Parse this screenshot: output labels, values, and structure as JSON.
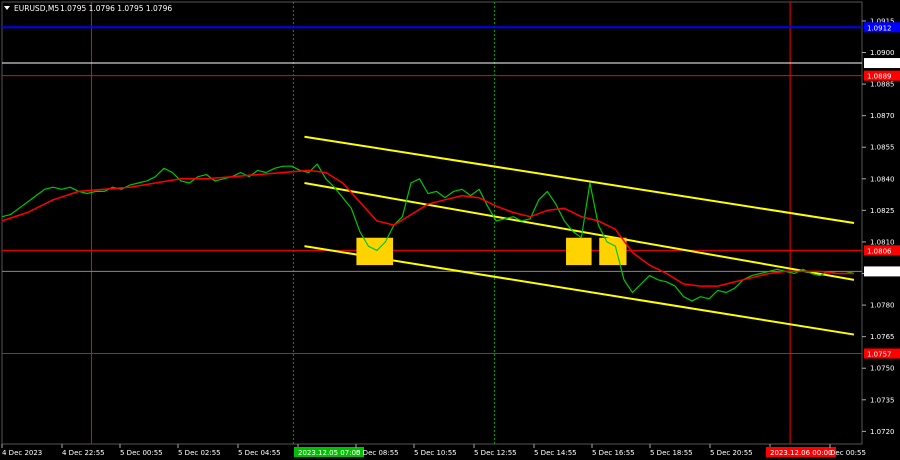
{
  "header": {
    "symbol": "EURUSD,M5",
    "ohlc": "1.0795 1.0796 1.0795 1.0796"
  },
  "colors": {
    "background": "#000000",
    "grid": "#2b2b2b",
    "price_line": "#00c800",
    "moving_average": "#ff0000",
    "channel": "#ffff00",
    "signal_box": "#ffd200",
    "level_red": "#ff0000",
    "level_blue": "#0000ff",
    "level_white": "#ffffff",
    "vertical_green": "#00a000"
  },
  "chart_data": {
    "type": "line",
    "y_ticks": [
      "1.0915",
      "1.0900",
      "1.0885",
      "1.0870",
      "1.0855",
      "1.0840",
      "1.0825",
      "1.0810",
      "1.0795",
      "1.0780",
      "1.0765",
      "1.0750",
      "1.0735",
      "1.0720"
    ],
    "x_ticks": [
      "4 Dec 2023",
      "4 Dec 22:55",
      "5 Dec 00:55",
      "5 Dec 02:55",
      "5 Dec 04:55",
      "2023.12.05 07:00",
      "5 Dec 08:55",
      "5 Dec 10:55",
      "5 Dec 12:55",
      "5 Dec 14:55",
      "5 Dec 16:55",
      "5 Dec 18:55",
      "5 Dec 20:55",
      "2023.12.06 00:00",
      "Dec 00:55"
    ],
    "ylim": [
      1.0714,
      1.0924
    ],
    "x_positions_bars": [
      0,
      100
    ],
    "horizontal_levels": [
      {
        "price": 1.0912,
        "color": "#0000ff",
        "label": "1.0912"
      },
      {
        "price": 1.0895,
        "color": "#ffffff",
        "label": "1.0895"
      },
      {
        "price": 1.0889,
        "color": "#ff0000",
        "label": "1.0889"
      },
      {
        "price": 1.0806,
        "color": "#ff0000",
        "label": "1.0806"
      },
      {
        "price": 1.0757,
        "color": "#ff0000",
        "label": "1.0757"
      }
    ],
    "current_price": {
      "price": 1.0796,
      "label": "1.0796"
    },
    "vertical_lines": [
      {
        "at": 10.5,
        "color": "#ff0000",
        "style": "solid"
      },
      {
        "at": 34.2,
        "color": "#00a000",
        "style": "dotted",
        "label": "2023.12.05 07:00"
      },
      {
        "at": 57.8,
        "color": "#00a000",
        "style": "dotted"
      },
      {
        "at": 92.5,
        "color": "#ff0000",
        "style": "solid",
        "label": "2023.12.06 00:00"
      }
    ],
    "channel_lines": [
      {
        "x": [
          35.5,
          100
        ],
        "y": [
          1.086,
          1.0819
        ]
      },
      {
        "x": [
          35.5,
          100
        ],
        "y": [
          1.0838,
          1.0792
        ]
      },
      {
        "x": [
          35.5,
          100
        ],
        "y": [
          1.0808,
          1.0766
        ]
      }
    ],
    "signal_boxes": [
      {
        "x": [
          41.6,
          45.9
        ],
        "y": [
          1.0812,
          1.0799
        ]
      },
      {
        "x": [
          66.2,
          69.2
        ],
        "y": [
          1.0812,
          1.0799
        ]
      },
      {
        "x": [
          70.1,
          73.3
        ],
        "y": [
          1.0812,
          1.0799
        ]
      }
    ],
    "series": [
      {
        "name": "EURUSD",
        "values": [
          [
            0,
            1.0822
          ],
          [
            1,
            1.0823
          ],
          [
            2,
            1.0826
          ],
          [
            3,
            1.0829
          ],
          [
            4,
            1.0832
          ],
          [
            5,
            1.0835
          ],
          [
            6,
            1.0836
          ],
          [
            7,
            1.0835
          ],
          [
            8,
            1.0836
          ],
          [
            9,
            1.0834
          ],
          [
            10,
            1.0833
          ],
          [
            11,
            1.0834
          ],
          [
            12,
            1.0834
          ],
          [
            13,
            1.0836
          ],
          [
            14,
            1.0835
          ],
          [
            15,
            1.0837
          ],
          [
            16,
            1.0838
          ],
          [
            17,
            1.0839
          ],
          [
            18,
            1.0841
          ],
          [
            19,
            1.0845
          ],
          [
            20,
            1.0843
          ],
          [
            21,
            1.0839
          ],
          [
            22,
            1.0838
          ],
          [
            23,
            1.0841
          ],
          [
            24,
            1.0842
          ],
          [
            25,
            1.0839
          ],
          [
            26,
            1.084
          ],
          [
            27,
            1.0841
          ],
          [
            28,
            1.0843
          ],
          [
            29,
            1.0841
          ],
          [
            30,
            1.0844
          ],
          [
            31,
            1.0843
          ],
          [
            32,
            1.0845
          ],
          [
            33,
            1.0846
          ],
          [
            34,
            1.0846
          ],
          [
            35,
            1.0844
          ],
          [
            36,
            1.0843
          ],
          [
            37,
            1.0847
          ],
          [
            38,
            1.084
          ],
          [
            39,
            1.0836
          ],
          [
            40,
            1.0831
          ],
          [
            41,
            1.0826
          ],
          [
            42,
            1.0815
          ],
          [
            43,
            1.0808
          ],
          [
            44,
            1.0806
          ],
          [
            45,
            1.081
          ],
          [
            46,
            1.0818
          ],
          [
            47,
            1.0822
          ],
          [
            48,
            1.0838
          ],
          [
            49,
            1.084
          ],
          [
            50,
            1.0833
          ],
          [
            51,
            1.0834
          ],
          [
            52,
            1.0831
          ],
          [
            53,
            1.0834
          ],
          [
            54,
            1.0835
          ],
          [
            55,
            1.0832
          ],
          [
            56,
            1.0835
          ],
          [
            57,
            1.0827
          ],
          [
            58,
            1.082
          ],
          [
            59,
            1.0821
          ],
          [
            60,
            1.0822
          ],
          [
            61,
            1.082
          ],
          [
            62,
            1.0821
          ],
          [
            63,
            1.083
          ],
          [
            64,
            1.0834
          ],
          [
            65,
            1.0828
          ],
          [
            66,
            1.082
          ],
          [
            67,
            1.0815
          ],
          [
            68,
            1.0812
          ],
          [
            69,
            1.0838
          ],
          [
            70,
            1.0818
          ],
          [
            71,
            1.081
          ],
          [
            72,
            1.0808
          ],
          [
            73,
            1.0792
          ],
          [
            74,
            1.0786
          ],
          [
            75,
            1.079
          ],
          [
            76,
            1.0794
          ],
          [
            77,
            1.0792
          ],
          [
            78,
            1.0791
          ],
          [
            79,
            1.0789
          ],
          [
            80,
            1.0784
          ],
          [
            81,
            1.0782
          ],
          [
            82,
            1.0784
          ],
          [
            83,
            1.0783
          ],
          [
            84,
            1.0787
          ],
          [
            85,
            1.0786
          ],
          [
            86,
            1.0788
          ],
          [
            87,
            1.0792
          ],
          [
            88,
            1.0794
          ],
          [
            89,
            1.0795
          ],
          [
            90,
            1.0796
          ],
          [
            91,
            1.0797
          ],
          [
            92,
            1.0796
          ],
          [
            93,
            1.0795
          ],
          [
            94,
            1.0797
          ],
          [
            95,
            1.0795
          ],
          [
            96,
            1.0794
          ],
          [
            97,
            1.0796
          ],
          [
            98,
            1.0795
          ],
          [
            99,
            1.0795
          ],
          [
            100,
            1.0796
          ]
        ]
      },
      {
        "name": "MA",
        "values": [
          [
            0,
            1.082
          ],
          [
            3,
            1.0824
          ],
          [
            6,
            1.083
          ],
          [
            9,
            1.0834
          ],
          [
            12,
            1.0835
          ],
          [
            15,
            1.0836
          ],
          [
            18,
            1.0838
          ],
          [
            21,
            1.084
          ],
          [
            24,
            1.084
          ],
          [
            27,
            1.0841
          ],
          [
            30,
            1.0842
          ],
          [
            33,
            1.0843
          ],
          [
            36,
            1.0844
          ],
          [
            38,
            1.0843
          ],
          [
            40,
            1.0838
          ],
          [
            42,
            1.0829
          ],
          [
            44,
            1.082
          ],
          [
            46,
            1.0818
          ],
          [
            48,
            1.0823
          ],
          [
            50,
            1.0828
          ],
          [
            52,
            1.083
          ],
          [
            54,
            1.0832
          ],
          [
            56,
            1.0831
          ],
          [
            58,
            1.0827
          ],
          [
            60,
            1.0824
          ],
          [
            62,
            1.0822
          ],
          [
            64,
            1.0825
          ],
          [
            66,
            1.0826
          ],
          [
            68,
            1.0822
          ],
          [
            70,
            1.082
          ],
          [
            72,
            1.0816
          ],
          [
            74,
            1.0805
          ],
          [
            76,
            1.0799
          ],
          [
            78,
            1.0795
          ],
          [
            80,
            1.079
          ],
          [
            82,
            1.0789
          ],
          [
            84,
            1.0789
          ],
          [
            86,
            1.0791
          ],
          [
            88,
            1.0793
          ],
          [
            90,
            1.0795
          ],
          [
            92,
            1.0796
          ],
          [
            94,
            1.0796
          ],
          [
            96,
            1.0796
          ],
          [
            98,
            1.0795
          ],
          [
            100,
            1.0795
          ]
        ]
      }
    ],
    "grid": false,
    "legend": "none"
  }
}
